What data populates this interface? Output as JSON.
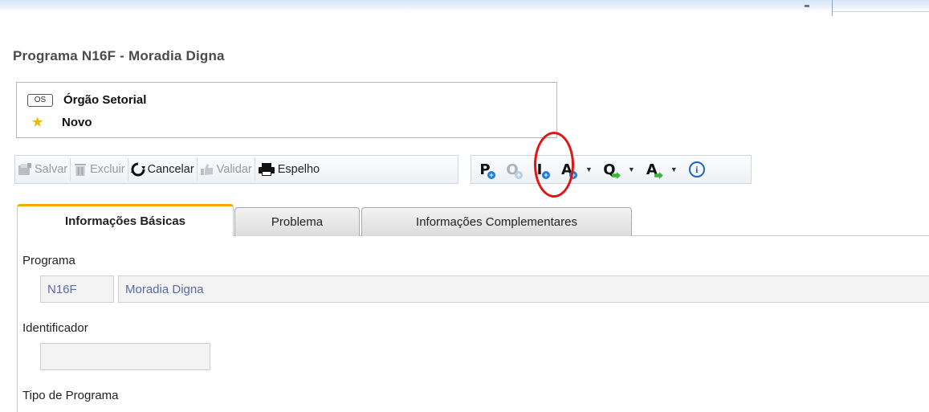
{
  "page": {
    "title": "Programa N16F - Moradia Digna"
  },
  "status": {
    "badge": "OS",
    "org": "Órgão Setorial",
    "state": "Novo"
  },
  "toolbar": {
    "save": "Salvar",
    "delete": "Excluir",
    "cancel": "Cancelar",
    "validate": "Validar",
    "mirror": "Espelho",
    "letters": {
      "p": "P",
      "o": "O",
      "i": "I",
      "a": "A",
      "q": "Q",
      "a2": "A"
    },
    "info": "i"
  },
  "tabs": [
    {
      "label": "Informações Básicas",
      "active": true
    },
    {
      "label": "Problema",
      "active": false
    },
    {
      "label": "Informações Complementares",
      "active": false
    }
  ],
  "form": {
    "programa_label": "Programa",
    "programa_code": "N16F",
    "programa_name": "Moradia Digna",
    "identificador_label": "Identificador",
    "identificador_value": "",
    "tipo_label": "Tipo de Programa"
  },
  "colors": {
    "accent_tab": "#f2a900",
    "highlight_circle": "#e01515",
    "link_blue": "#1f7fd6"
  }
}
